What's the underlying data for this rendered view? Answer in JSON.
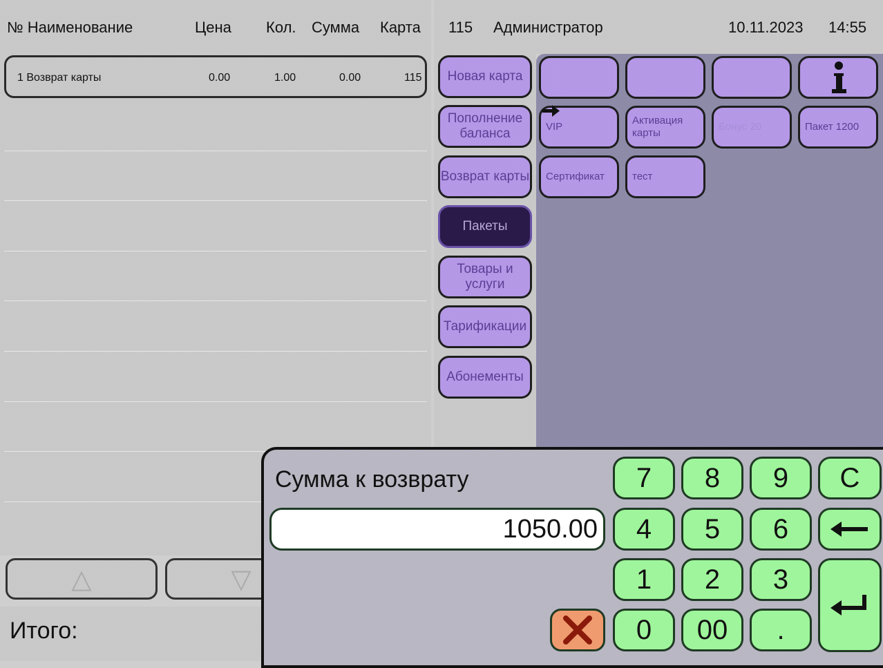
{
  "header": {
    "col_name": "№ Наименование",
    "col_price": "Цена",
    "col_qty": "Кол.",
    "col_sum": "Сумма",
    "col_card": "Карта",
    "terminal_no": "115",
    "operator": "Администратор",
    "date": "10.11.2023",
    "time": "14:55"
  },
  "receipt": {
    "rows": [
      {
        "no_name": "1 Возврат карты",
        "price": "0.00",
        "qty": "1.00",
        "sum": "0.00",
        "card": "115"
      }
    ]
  },
  "total": {
    "label": "Итого:"
  },
  "categories": [
    {
      "label": "Новая карта"
    },
    {
      "label": "Пополнение баланса"
    },
    {
      "label": "Возврат карты"
    },
    {
      "label": "Пакеты",
      "active": true
    },
    {
      "label": "Товары и услуги"
    },
    {
      "label": "Тарификации"
    },
    {
      "label": "Абонементы"
    }
  ],
  "items": [
    {
      "label": ""
    },
    {
      "label": ""
    },
    {
      "label": ""
    },
    {
      "label": "",
      "icon": "info-icon"
    },
    {
      "label": "VIP",
      "icon": "arrow-right-icon"
    },
    {
      "label": "Активация карты"
    },
    {
      "label": "Бонус 20"
    },
    {
      "label": "Пакет 1200"
    },
    {
      "label": "Сертификат"
    },
    {
      "label": "тест"
    }
  ],
  "dialog": {
    "title": "Сумма к возврату",
    "amount": "1050.00",
    "keys": [
      "7",
      "8",
      "9",
      "C",
      "4",
      "5",
      "6",
      "1",
      "2",
      "3",
      "0",
      "00",
      "."
    ],
    "cancel_icon": "close-icon",
    "backspace_icon": "backspace-arrow-icon",
    "enter_icon": "enter-icon"
  },
  "colors": {
    "category_bg": "#b397e6",
    "category_active_bg": "#2a1a4a",
    "keypad_bg": "#9ff59b",
    "cancel_bg": "#f09b6f",
    "items_panel_bg": "#8d8aac"
  }
}
